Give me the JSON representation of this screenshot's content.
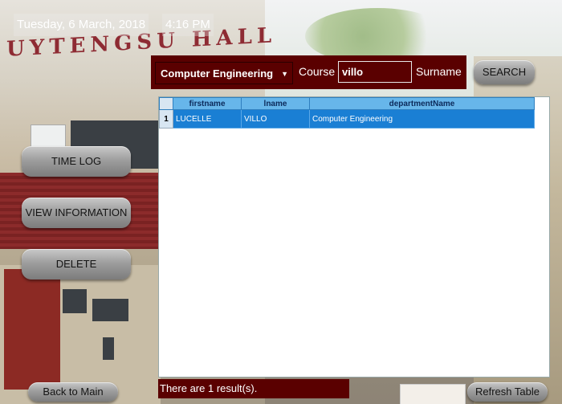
{
  "header": {
    "date": "Tuesday, 6 March, 2018",
    "time": "4:16 PM",
    "building_sign": "UYTENGSU HALL"
  },
  "search": {
    "department_selected": "Computer Engineering",
    "course_label": "Course",
    "surname_value": "villo",
    "surname_label": "Surname",
    "search_button": "SEARCH"
  },
  "sidebar": {
    "time_log": "TIME LOG",
    "view_information": "VIEW INFORMATION",
    "delete": "DELETE"
  },
  "table": {
    "columns": [
      "firstname",
      "lname",
      "departmentName"
    ],
    "rows": [
      {
        "index": "1",
        "firstname": "LUCELLE",
        "lname": "VILLO",
        "departmentName": "Computer Engineering"
      }
    ]
  },
  "status": {
    "result_text": "There are 1 result(s)."
  },
  "footer": {
    "back_button": "Back to Main",
    "refresh_button": "Refresh Table"
  },
  "colors": {
    "bar_maroon": "#5a0000",
    "grid_header": "#67b6ea",
    "selected_row": "#1a7fd4"
  }
}
